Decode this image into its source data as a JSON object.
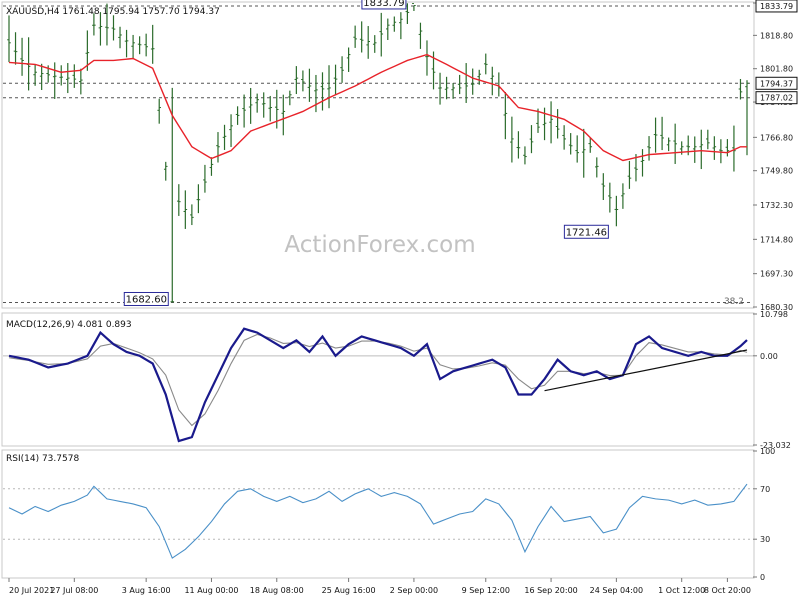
{
  "chart_data": [
    {
      "type": "bar",
      "panel": "price",
      "header": "XAUUSD,H4  1761.48 1795.94 1757.70 1794.37",
      "symbol": "XAUUSD",
      "timeframe": "H4",
      "ohlc": {
        "open": 1761.48,
        "high": 1795.94,
        "low": 1757.7,
        "close": 1794.37
      },
      "ylim": [
        1680.3,
        1835.3
      ],
      "y_ticks": [
        "1835.30",
        "1818.80",
        "1801.80",
        "1784.80",
        "1766.80",
        "1749.80",
        "1732.30",
        "1714.80",
        "1697.30",
        "1680.30"
      ],
      "x_ticks": [
        "20 Jul 2021",
        "27 Jul 08:00",
        "3 Aug 16:00",
        "11 Aug 00:00",
        "18 Aug 08:00",
        "25 Aug 16:00",
        "2 Sep 00:00",
        "9 Sep 12:00",
        "16 Sep 20:00",
        "24 Sep 04:00",
        "1 Oct 12:00",
        "8 Oct 20:00"
      ],
      "price_tags": [
        "1833.79",
        "1794.37",
        "1787.02"
      ],
      "horizontal_levels": [
        1833.79,
        1794.37,
        1787.02,
        1682.6
      ],
      "level_note": "38.2",
      "annotations": [
        {
          "text": "1833.79",
          "x": "2 Sep 00:00",
          "y": 1833.79
        },
        {
          "text": "1682.60",
          "x": "9 Aug 00:00",
          "y": 1682.6
        },
        {
          "text": "1721.46",
          "x": "29 Sep 12:00",
          "y": 1721.46
        }
      ],
      "price_path": [
        [
          0,
          1815
        ],
        [
          2,
          1806
        ],
        [
          4,
          1800
        ],
        [
          7,
          1798
        ],
        [
          9,
          1797
        ],
        [
          11,
          1796
        ],
        [
          13,
          1824
        ],
        [
          16,
          1822
        ],
        [
          18,
          1816
        ],
        [
          20,
          1814
        ],
        [
          22,
          1812
        ],
        [
          24,
          1752
        ],
        [
          25,
          1683
        ],
        [
          26,
          1734
        ],
        [
          28,
          1726
        ],
        [
          30,
          1744
        ],
        [
          32,
          1762
        ],
        [
          35,
          1778
        ],
        [
          38,
          1786
        ],
        [
          40,
          1782
        ],
        [
          42,
          1780
        ],
        [
          44,
          1797
        ],
        [
          47,
          1791
        ],
        [
          49,
          1792
        ],
        [
          51,
          1801
        ],
        [
          53,
          1817
        ],
        [
          56,
          1815
        ],
        [
          58,
          1824
        ],
        [
          60,
          1827
        ],
        [
          62,
          1834
        ],
        [
          64,
          1808
        ],
        [
          66,
          1792
        ],
        [
          69,
          1792
        ],
        [
          71,
          1794
        ],
        [
          73,
          1804
        ],
        [
          75,
          1792
        ],
        [
          77,
          1766
        ],
        [
          79,
          1757
        ],
        [
          81,
          1772
        ],
        [
          83,
          1776
        ],
        [
          85,
          1766
        ],
        [
          87,
          1759
        ],
        [
          89,
          1762
        ],
        [
          91,
          1742
        ],
        [
          93,
          1730
        ],
        [
          95,
          1746
        ],
        [
          97,
          1755
        ],
        [
          99,
          1768
        ],
        [
          101,
          1765
        ],
        [
          103,
          1762
        ],
        [
          105,
          1762
        ],
        [
          107,
          1764
        ],
        [
          109,
          1760
        ],
        [
          111,
          1760
        ],
        [
          112,
          1790
        ],
        [
          113,
          1794.37
        ]
      ],
      "series": [
        {
          "color": "#2b6b2b",
          "values": []
        },
        {
          "color": "#e8232a",
          "values": [
            [
              0,
              1805
            ],
            [
              4,
              1804
            ],
            [
              8,
              1800
            ],
            [
              11,
              1801
            ],
            [
              13,
              1806
            ],
            [
              16,
              1806
            ],
            [
              19,
              1807
            ],
            [
              22,
              1802
            ],
            [
              25,
              1778
            ],
            [
              28,
              1762
            ],
            [
              31,
              1756
            ],
            [
              34,
              1760
            ],
            [
              37,
              1770
            ],
            [
              41,
              1775
            ],
            [
              45,
              1780
            ],
            [
              49,
              1787
            ],
            [
              53,
              1793
            ],
            [
              57,
              1800
            ],
            [
              61,
              1806
            ],
            [
              64,
              1809
            ],
            [
              67,
              1804
            ],
            [
              71,
              1797
            ],
            [
              75,
              1793
            ],
            [
              78,
              1782
            ],
            [
              81,
              1780
            ],
            [
              85,
              1776
            ],
            [
              88,
              1770
            ],
            [
              91,
              1760
            ],
            [
              94,
              1755
            ],
            [
              98,
              1758
            ],
            [
              102,
              1759
            ],
            [
              106,
              1760
            ],
            [
              110,
              1759
            ],
            [
              112,
              1762
            ]
          ]
        }
      ]
    },
    {
      "type": "line",
      "panel": "macd",
      "header": "MACD(12,26,9) 4.081 0.893",
      "ylim": [
        -23.032,
        10.798
      ],
      "y_ticks": [
        "10.798",
        "0.00",
        "-23.032"
      ],
      "macd": [
        [
          0,
          0
        ],
        [
          3,
          -1
        ],
        [
          6,
          -3
        ],
        [
          9,
          -2
        ],
        [
          12,
          0
        ],
        [
          14,
          6
        ],
        [
          16,
          3
        ],
        [
          18,
          1
        ],
        [
          20,
          0
        ],
        [
          22,
          -2
        ],
        [
          24,
          -10
        ],
        [
          26,
          -22
        ],
        [
          28,
          -21
        ],
        [
          30,
          -12
        ],
        [
          32,
          -5
        ],
        [
          34,
          2
        ],
        [
          36,
          7
        ],
        [
          38,
          6
        ],
        [
          40,
          4
        ],
        [
          42,
          2
        ],
        [
          44,
          4
        ],
        [
          46,
          1
        ],
        [
          48,
          5
        ],
        [
          50,
          0
        ],
        [
          52,
          3
        ],
        [
          54,
          5
        ],
        [
          56,
          4
        ],
        [
          58,
          3
        ],
        [
          60,
          2
        ],
        [
          62,
          0
        ],
        [
          64,
          3
        ],
        [
          66,
          -6
        ],
        [
          68,
          -4
        ],
        [
          70,
          -3
        ],
        [
          72,
          -2
        ],
        [
          74,
          -1
        ],
        [
          76,
          -3
        ],
        [
          78,
          -10
        ],
        [
          80,
          -10
        ],
        [
          82,
          -6
        ],
        [
          84,
          -1
        ],
        [
          86,
          -4
        ],
        [
          88,
          -5
        ],
        [
          90,
          -4
        ],
        [
          92,
          -6
        ],
        [
          94,
          -5
        ],
        [
          96,
          3
        ],
        [
          98,
          5
        ],
        [
          100,
          2
        ],
        [
          102,
          1
        ],
        [
          104,
          0
        ],
        [
          106,
          1
        ],
        [
          108,
          0
        ],
        [
          110,
          0
        ],
        [
          112,
          2.5
        ],
        [
          113,
          4.081
        ]
      ],
      "signal": [
        [
          0,
          -0.5
        ],
        [
          3,
          -1.2
        ],
        [
          6,
          -2.2
        ],
        [
          9,
          -2
        ],
        [
          12,
          -0.8
        ],
        [
          14,
          2.5
        ],
        [
          16,
          3.2
        ],
        [
          18,
          2
        ],
        [
          20,
          0.8
        ],
        [
          22,
          -0.8
        ],
        [
          24,
          -5
        ],
        [
          26,
          -14
        ],
        [
          28,
          -18
        ],
        [
          30,
          -15
        ],
        [
          32,
          -9
        ],
        [
          34,
          -2
        ],
        [
          36,
          4
        ],
        [
          38,
          5.5
        ],
        [
          40,
          4.6
        ],
        [
          42,
          3.2
        ],
        [
          44,
          3.4
        ],
        [
          46,
          2.4
        ],
        [
          48,
          3.3
        ],
        [
          50,
          2
        ],
        [
          52,
          2.5
        ],
        [
          54,
          3.8
        ],
        [
          56,
          3.8
        ],
        [
          58,
          3.3
        ],
        [
          60,
          2.5
        ],
        [
          62,
          1.2
        ],
        [
          64,
          2
        ],
        [
          66,
          -2.3
        ],
        [
          68,
          -3.4
        ],
        [
          70,
          -3.2
        ],
        [
          72,
          -2.6
        ],
        [
          74,
          -1.8
        ],
        [
          76,
          -2.4
        ],
        [
          78,
          -6
        ],
        [
          80,
          -8.5
        ],
        [
          82,
          -7.6
        ],
        [
          84,
          -4
        ],
        [
          86,
          -4
        ],
        [
          88,
          -4.6
        ],
        [
          90,
          -4.3
        ],
        [
          92,
          -5.1
        ],
        [
          94,
          -5
        ],
        [
          96,
          0
        ],
        [
          98,
          3.4
        ],
        [
          100,
          2.8
        ],
        [
          102,
          1.9
        ],
        [
          104,
          1
        ],
        [
          106,
          1
        ],
        [
          108,
          0.5
        ],
        [
          110,
          0.2
        ],
        [
          112,
          1.4
        ],
        [
          113,
          0.893
        ]
      ],
      "trendline": [
        [
          82,
          -9
        ],
        [
          113,
          1.5
        ]
      ]
    },
    {
      "type": "line",
      "panel": "rsi",
      "header": "RSI(14) 73.7578",
      "ylim": [
        0,
        100
      ],
      "y_ticks": [
        "100",
        "70",
        "30",
        "0"
      ],
      "levels": [
        70,
        30
      ],
      "values": [
        [
          0,
          55
        ],
        [
          2,
          50
        ],
        [
          4,
          56
        ],
        [
          6,
          52
        ],
        [
          8,
          57
        ],
        [
          10,
          60
        ],
        [
          12,
          65
        ],
        [
          13,
          72
        ],
        [
          15,
          62
        ],
        [
          17,
          60
        ],
        [
          19,
          58
        ],
        [
          21,
          55
        ],
        [
          23,
          40
        ],
        [
          25,
          15
        ],
        [
          27,
          22
        ],
        [
          29,
          32
        ],
        [
          31,
          44
        ],
        [
          33,
          58
        ],
        [
          35,
          68
        ],
        [
          37,
          70
        ],
        [
          39,
          64
        ],
        [
          41,
          60
        ],
        [
          43,
          64
        ],
        [
          45,
          59
        ],
        [
          47,
          62
        ],
        [
          49,
          68
        ],
        [
          51,
          60
        ],
        [
          53,
          66
        ],
        [
          55,
          70
        ],
        [
          57,
          64
        ],
        [
          59,
          67
        ],
        [
          61,
          64
        ],
        [
          63,
          58
        ],
        [
          65,
          42
        ],
        [
          67,
          46
        ],
        [
          69,
          50
        ],
        [
          71,
          52
        ],
        [
          73,
          62
        ],
        [
          75,
          58
        ],
        [
          77,
          45
        ],
        [
          79,
          20
        ],
        [
          81,
          40
        ],
        [
          83,
          56
        ],
        [
          85,
          44
        ],
        [
          87,
          46
        ],
        [
          89,
          48
        ],
        [
          91,
          35
        ],
        [
          93,
          38
        ],
        [
          95,
          55
        ],
        [
          97,
          64
        ],
        [
          99,
          62
        ],
        [
          101,
          61
        ],
        [
          103,
          58
        ],
        [
          105,
          61
        ],
        [
          107,
          57
        ],
        [
          109,
          58
        ],
        [
          111,
          60
        ],
        [
          113,
          73.7578
        ]
      ]
    }
  ],
  "watermark": "ActionForex.com",
  "colors": {
    "bars": "#2b6b2b",
    "ema": "#e8232a",
    "macd": "#1a1a8c",
    "signal": "#8a8a8a",
    "rsi": "#4a90c8",
    "trend": "#111111"
  }
}
